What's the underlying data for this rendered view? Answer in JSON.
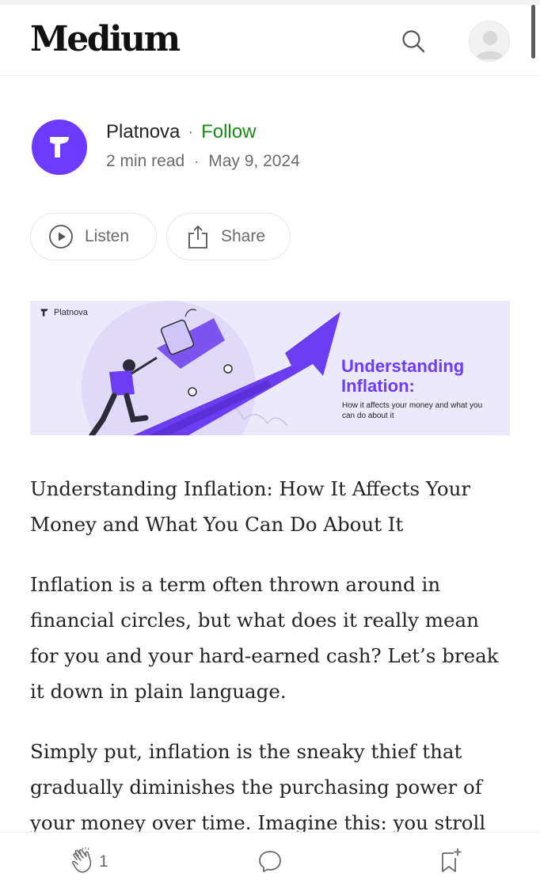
{
  "header": {
    "logo": "Medium",
    "icons": {
      "search": "search-icon",
      "avatar": "user-avatar-icon"
    }
  },
  "author": {
    "name": "Platnova",
    "separator": "·",
    "follow_label": "Follow",
    "read_time": "2 min read",
    "date": "May 9, 2024",
    "avatar_icon": "platnova-logo-icon",
    "brand_color": "#6c3bff",
    "follow_color": "#1a8917"
  },
  "actions": {
    "listen_label": "Listen",
    "share_label": "Share",
    "icons": {
      "listen": "play-circle-icon",
      "share": "share-icon"
    }
  },
  "hero": {
    "brand": "Platnova",
    "title": "Understanding Inflation:",
    "subtitle": "How it affects your money and what you can do about it"
  },
  "article": {
    "paragraphs": [
      "Understanding Inflation: How It Affects Your Money and What You Can Do About It",
      "Inflation is a term often thrown around in financial circles, but what does it really mean for you and your hard-earned cash? Let’s break it down in plain language.",
      "Simply put, inflation is the sneaky thief that gradually diminishes the purchasing power of your money over time. Imagine this: you stroll"
    ]
  },
  "bottom_bar": {
    "clap_count": "1",
    "icons": {
      "clap": "clap-icon",
      "comment": "comment-icon",
      "bookmark": "bookmark-add-icon"
    }
  }
}
